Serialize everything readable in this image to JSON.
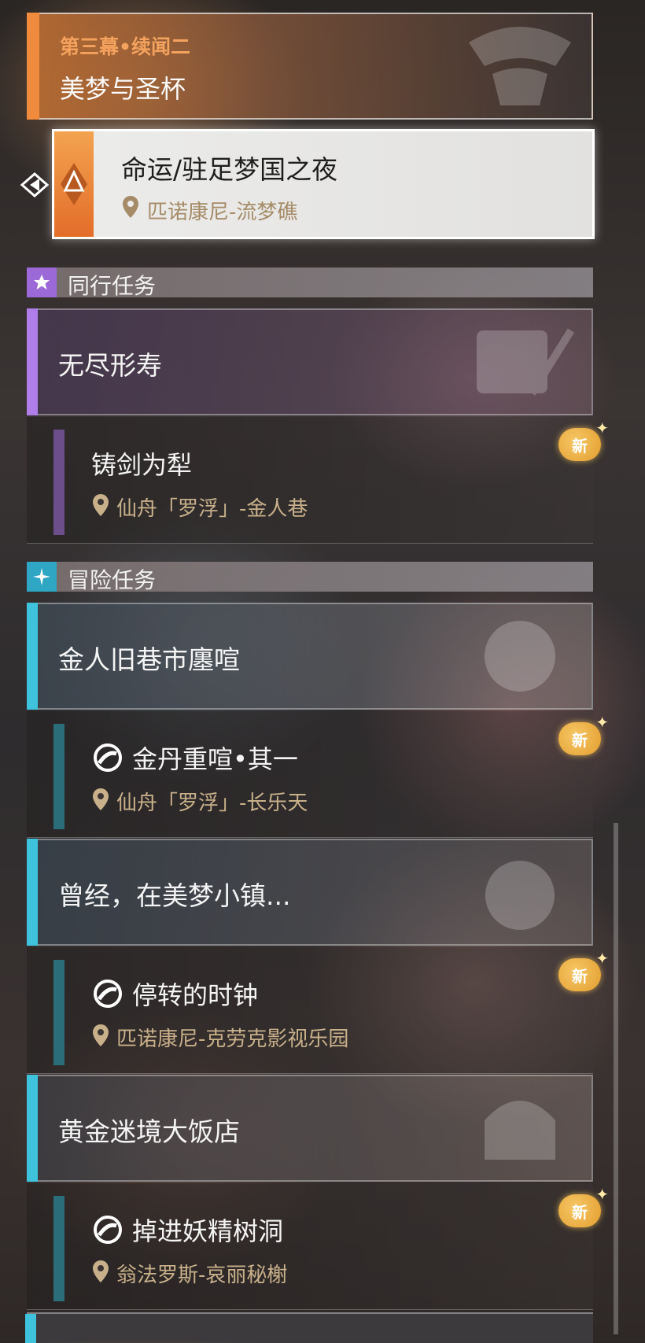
{
  "main_quest": {
    "chapter": "第三幕•续闻二",
    "title": "美梦与圣杯",
    "accent": "#f08a3c",
    "active_sub": {
      "title": "命运/驻足梦国之夜",
      "location": "匹诺康尼-流梦礁"
    }
  },
  "companion_section": {
    "header": "同行任务",
    "accent": "#b07ee8",
    "groups": [
      {
        "title": "无尽形寿",
        "subs": [
          {
            "title": "铸剑为犁",
            "location": "仙舟「罗浮」-金人巷",
            "badge": "新"
          }
        ]
      }
    ]
  },
  "adventure_section": {
    "header": "冒险任务",
    "accent": "#3fc3dc",
    "groups": [
      {
        "title": "金人旧巷市廛喧",
        "subs": [
          {
            "title": "金丹重喧•其一",
            "location": "仙舟「罗浮」-长乐天",
            "badge": "新"
          }
        ]
      },
      {
        "title": "曾经，在美梦小镇...",
        "subs": [
          {
            "title": "停转的时钟",
            "location": "匹诺康尼-克劳克影视乐园",
            "badge": "新"
          }
        ]
      },
      {
        "title": "黄金迷境大饭店",
        "subs": [
          {
            "title": "掉进妖精树洞",
            "location": "翁法罗斯-哀丽秘榭",
            "badge": "新"
          }
        ]
      }
    ]
  }
}
